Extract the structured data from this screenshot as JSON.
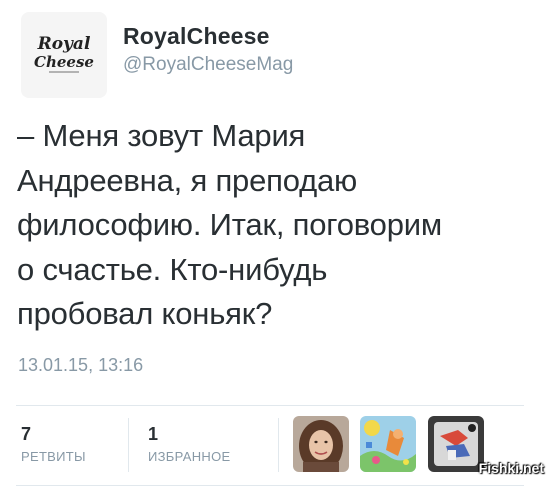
{
  "author": {
    "name": "RoyalCheese",
    "handle": "@RoyalCheeseMag",
    "avatar_logo": "Royal Cheese"
  },
  "tweet": {
    "text": "– Меня зовут Мария\nАндреевна, я преподаю\nфилософию. Итак, поговорим\nо счастье. Кто-нибудь\nпробовал коньяк?",
    "timestamp": "13.01.15, 13:16"
  },
  "stats": {
    "retweets": {
      "count": "7",
      "label": "РЕТВИТЫ"
    },
    "favorites": {
      "count": "1",
      "label": "ИЗБРАННОЕ"
    }
  },
  "favorited_by": [
    {
      "icon": "user-avatar-woman"
    },
    {
      "icon": "user-avatar-illustration"
    },
    {
      "icon": "user-avatar-dark"
    }
  ],
  "watermark": "Fishki.net",
  "colors": {
    "text": "#292f33",
    "muted": "#8899a6",
    "divider": "#e1e8ed"
  }
}
